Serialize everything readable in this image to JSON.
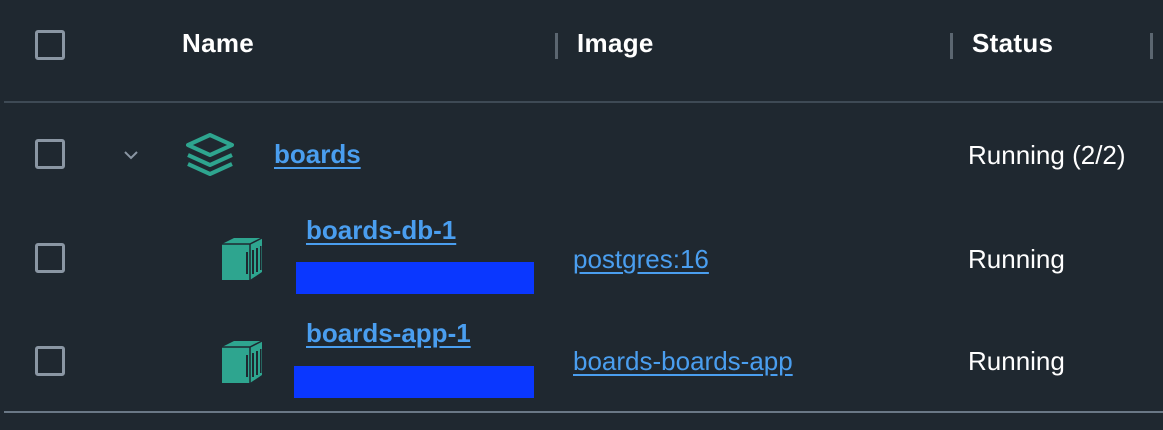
{
  "table": {
    "columns": {
      "name": "Name",
      "image": "Image",
      "status": "Status"
    },
    "group": {
      "name": "boards",
      "status": "Running (2/2)",
      "icon": "stack-icon",
      "expanded": true
    },
    "rows": [
      {
        "name": "boards-db-1",
        "image": "postgres:16",
        "status": "Running",
        "icon": "container-icon"
      },
      {
        "name": "boards-app-1",
        "image": "boards-boards-app",
        "status": "Running",
        "icon": "container-icon"
      }
    ]
  },
  "colors": {
    "background": "#1f2830",
    "link": "#4a9eef",
    "icon_teal": "#2ea58f",
    "redaction": "#0a37ff"
  }
}
